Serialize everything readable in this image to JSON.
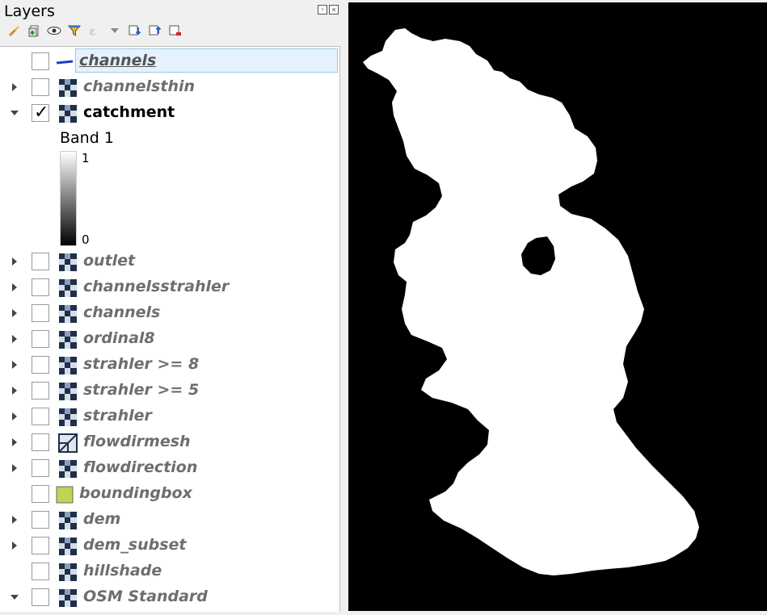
{
  "panel": {
    "title": "Layers",
    "float_glyph": "▫",
    "close_glyph": "×"
  },
  "toolbar": {
    "buttons": [
      {
        "name": "style-manager-icon"
      },
      {
        "name": "add-group-icon"
      },
      {
        "name": "manage-visibility-icon"
      },
      {
        "name": "filter-legend-icon"
      },
      {
        "name": "filter-expression-icon"
      },
      {
        "name": "filter-dropdown-icon"
      },
      {
        "name": "expand-all-icon"
      },
      {
        "name": "collapse-all-icon"
      },
      {
        "name": "remove-layer-icon"
      }
    ]
  },
  "layers": [
    {
      "label": "channels",
      "checked": false,
      "icon": "line-icon",
      "expand": "none",
      "selected": true
    },
    {
      "label": "channelsthin",
      "checked": false,
      "icon": "raster-icon",
      "expand": "collapsed"
    },
    {
      "label": "catchment",
      "checked": true,
      "icon": "raster-icon",
      "expand": "expanded",
      "active": true
    },
    {
      "label": "outlet",
      "checked": false,
      "icon": "raster-icon",
      "expand": "collapsed"
    },
    {
      "label": "channelsstrahler",
      "checked": false,
      "icon": "raster-icon",
      "expand": "collapsed"
    },
    {
      "label": "channels",
      "checked": false,
      "icon": "raster-icon",
      "expand": "collapsed"
    },
    {
      "label": "ordinal8",
      "checked": false,
      "icon": "raster-icon",
      "expand": "collapsed"
    },
    {
      "label": "strahler >= 8",
      "checked": false,
      "icon": "raster-icon",
      "expand": "collapsed"
    },
    {
      "label": "strahler >= 5",
      "checked": false,
      "icon": "raster-icon",
      "expand": "collapsed"
    },
    {
      "label": "strahler",
      "checked": false,
      "icon": "raster-icon",
      "expand": "collapsed"
    },
    {
      "label": "flowdirmesh",
      "checked": false,
      "icon": "mesh-icon",
      "expand": "collapsed"
    },
    {
      "label": "flowdirection",
      "checked": false,
      "icon": "raster-icon",
      "expand": "collapsed"
    },
    {
      "label": "boundingbox",
      "checked": false,
      "icon": "polygon-icon",
      "expand": "none"
    },
    {
      "label": "dem",
      "checked": false,
      "icon": "raster-icon",
      "expand": "collapsed"
    },
    {
      "label": "dem_subset",
      "checked": false,
      "icon": "raster-icon",
      "expand": "collapsed"
    },
    {
      "label": "hillshade",
      "checked": false,
      "icon": "raster-icon",
      "expand": "none"
    },
    {
      "label": "OSM Standard",
      "checked": false,
      "icon": "raster-icon",
      "expand": "expanded"
    }
  ],
  "legend": {
    "band_label": "Band 1",
    "max": "1",
    "min": "0"
  },
  "colors": {
    "selection_bg": "#e6f2fb",
    "line_symbol": "#1f3fbf",
    "polygon_symbol": "#c4d254",
    "map_background": "#000000",
    "catchment_fill": "#ffffff"
  }
}
